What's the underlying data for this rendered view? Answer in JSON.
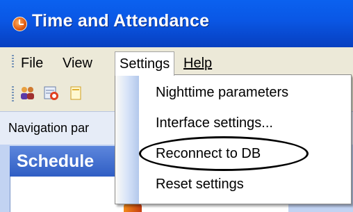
{
  "window": {
    "title": "Time and Attendance"
  },
  "menubar": {
    "items": [
      {
        "label": "File"
      },
      {
        "label": "View"
      },
      {
        "label": "Settings"
      },
      {
        "label": "Help"
      }
    ]
  },
  "toolbar": {
    "icons": [
      "users-icon",
      "schedule-clock-icon",
      "document-icon"
    ]
  },
  "navigation": {
    "label": "Navigation par"
  },
  "panel": {
    "header": "Schedule"
  },
  "settings_menu": {
    "items": [
      {
        "label": "Nighttime parameters"
      },
      {
        "label": "Interface settings..."
      },
      {
        "label": "Reconnect to DB",
        "highlighted_with_ellipse": true
      },
      {
        "label": "Reset settings"
      }
    ]
  },
  "colors": {
    "titlebar": "#0a58e6",
    "nav_panel": "#c2d3f2",
    "menu_bg": "#ffffff"
  }
}
